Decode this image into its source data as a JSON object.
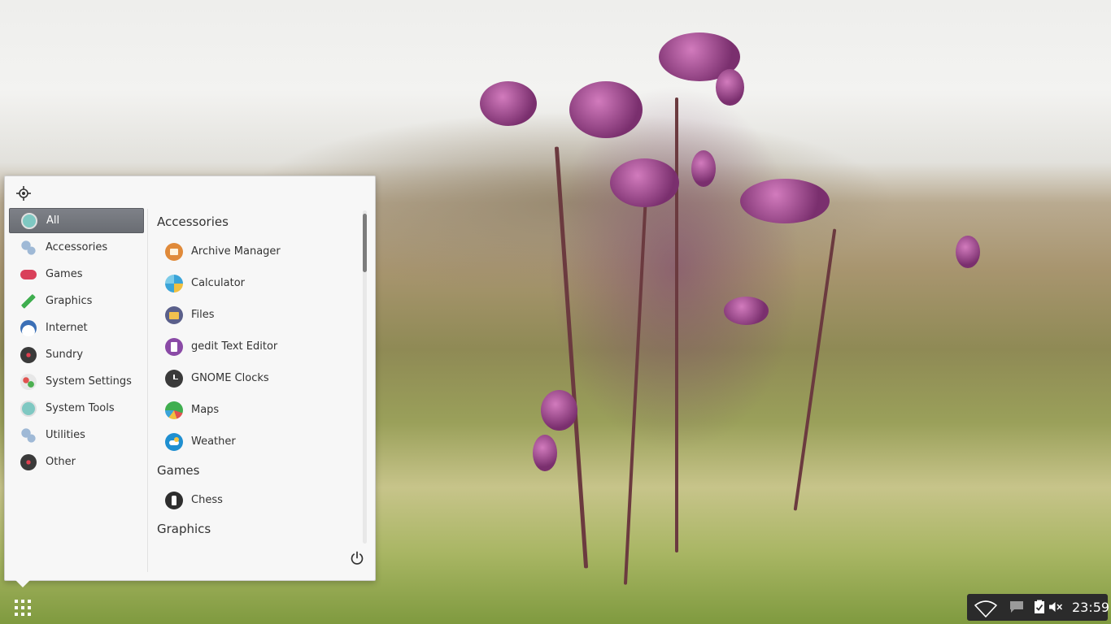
{
  "launcher": {
    "categories": [
      {
        "label": "All",
        "icon": "info-icon",
        "color": "#7fc8c2",
        "active": true
      },
      {
        "label": "Accessories",
        "icon": "gears-icon",
        "color": "#9fb9d6"
      },
      {
        "label": "Games",
        "icon": "gamepad-icon",
        "color": "#d9405a"
      },
      {
        "label": "Graphics",
        "icon": "graphics-icon",
        "color": "#3fae4f"
      },
      {
        "label": "Internet",
        "icon": "globe-icon",
        "color": "#3b6fb6"
      },
      {
        "label": "Sundry",
        "icon": "sundry-icon",
        "color": "#333333"
      },
      {
        "label": "System Settings",
        "icon": "toggles-icon",
        "color": "#e7e7e7"
      },
      {
        "label": "System Tools",
        "icon": "info-icon",
        "color": "#7fc8c2"
      },
      {
        "label": "Utilities",
        "icon": "gears-icon",
        "color": "#9fb9d6"
      },
      {
        "label": "Other",
        "icon": "other-icon",
        "color": "#333333"
      }
    ],
    "sections": [
      {
        "title": "Accessories",
        "apps": [
          {
            "label": "Archive Manager",
            "icon": "archive-icon",
            "color": "#e08a3a"
          },
          {
            "label": "Calculator",
            "icon": "calculator-icon",
            "color": "#3aa4d8"
          },
          {
            "label": "Files",
            "icon": "files-icon",
            "color": "#5a5f8a"
          },
          {
            "label": "gedit Text Editor",
            "icon": "text-editor-icon",
            "color": "#8a4aa6"
          },
          {
            "label": "GNOME Clocks",
            "icon": "clock-icon",
            "color": "#3a3a3a"
          },
          {
            "label": "Maps",
            "icon": "maps-icon",
            "color": "#3fae4f"
          },
          {
            "label": "Weather",
            "icon": "weather-icon",
            "color": "#1f8fd0"
          }
        ]
      },
      {
        "title": "Games",
        "apps": [
          {
            "label": "Chess",
            "icon": "chess-icon",
            "color": "#2e2e2e"
          }
        ]
      },
      {
        "title": "Graphics",
        "apps": []
      }
    ]
  },
  "tray": {
    "clock": "23:59",
    "icons": [
      "wifi-icon",
      "chat-icon",
      "clipboard-icon",
      "volume-muted-icon"
    ]
  }
}
